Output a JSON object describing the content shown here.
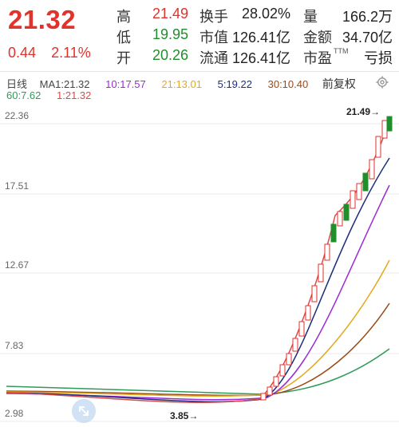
{
  "quote": {
    "price": "21.32",
    "change": "0.44",
    "change_pct": "2.11%",
    "stats": [
      {
        "label": "高",
        "value": "21.49",
        "color": "red"
      },
      {
        "label": "低",
        "value": "19.95",
        "color": "green"
      },
      {
        "label": "开",
        "value": "20.26",
        "color": "green"
      },
      {
        "label": "换手",
        "value": "28.02%",
        "color": "dark"
      },
      {
        "label": "市值",
        "value": "126.41亿",
        "color": "dark"
      },
      {
        "label": "流通",
        "value": "126.41亿",
        "color": "dark"
      },
      {
        "label": "量",
        "value": "166.2万",
        "color": "dark"
      },
      {
        "label": "金额",
        "value": "34.70亿",
        "color": "dark"
      },
      {
        "label": "市盈",
        "value": "亏损",
        "color": "dark",
        "suffix": "TTM"
      }
    ]
  },
  "indicators": {
    "period": "日线",
    "ma1": "MA1:21.32",
    "ma10": "10:17.57",
    "ma21": "21:13.01",
    "ma5": "5:19.22",
    "ma30": "30:10.40",
    "adjust": "前复权",
    "ma60": "60:7.62",
    "ma1b": "1:21.32"
  },
  "colors": {
    "ma1": "#d94a4a",
    "ma5": "#1c2f7a",
    "ma10": "#9c2bd6",
    "ma21": "#e3a91d",
    "ma30": "#9a4a16",
    "ma60": "#2f9a5a",
    "up": "#e1322c",
    "down": "#1f8f2c"
  },
  "axis": {
    "labels": [
      "22.36",
      "17.51",
      "12.67",
      "7.83",
      "2.98"
    ]
  },
  "chart_data": {
    "type": "line",
    "high_marker": "21.49→",
    "low_marker": "3.85→",
    "ylim": [
      2.98,
      22.36
    ]
  },
  "icons": {
    "settings": "gear-icon",
    "zoom": "expand-icon"
  }
}
